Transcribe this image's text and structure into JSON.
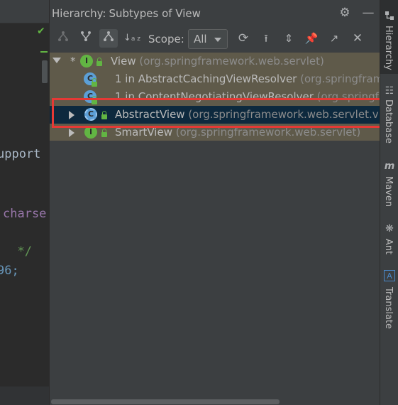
{
  "editor": {
    "code_lines": [
      {
        "text": "upport",
        "color": "#a9b7c6"
      },
      {
        "text": "charse",
        "color": "#9876aa"
      },
      {
        "text": "  */",
        "color": "#629755"
      },
      {
        "text": "96;",
        "color": "#6897bb"
      }
    ],
    "check_icon": "check-icon"
  },
  "panel": {
    "title": "Hierarchy:",
    "subtitle": "Subtypes of View",
    "scope_label": "Scope:",
    "scope_value": "All"
  },
  "tree": {
    "rows": [
      {
        "star": "*",
        "name": "View",
        "pkg": " (org.springframework.web.servlet)",
        "icon": "interface-icon",
        "icon_letter": "I"
      },
      {
        "prefix": "1 in ",
        "name": "AbstractCachingViewResolver",
        "pkg": " (org.springframework.web.servlet.view)",
        "icon": "class-icon",
        "icon_letter": "C"
      },
      {
        "prefix": "1 in ",
        "name": "ContentNegotiatingViewResolver",
        "pkg": " (org.springframework.web.servlet.view)",
        "icon": "class-icon",
        "icon_letter": "C"
      },
      {
        "name": "AbstractView",
        "pkg": " (org.springframework.web.servlet.view)",
        "icon": "abstract-class-icon",
        "icon_letter": "C"
      },
      {
        "name": "SmartView",
        "pkg": " (org.springframework.web.servlet)",
        "icon": "interface-icon",
        "icon_letter": "I"
      }
    ]
  },
  "strip": {
    "items": [
      {
        "label": "Hierarchy",
        "icon": "hierarchy-icon"
      },
      {
        "label": "Database",
        "icon": "database-icon"
      },
      {
        "label": "Maven",
        "icon": "maven-icon"
      },
      {
        "label": "Ant",
        "icon": "ant-icon"
      },
      {
        "label": "Translate",
        "icon": "translate-icon"
      }
    ]
  },
  "colors": {
    "tree_bg": "#5f5a4a",
    "selected_bg": "#0d293e",
    "highlight": "#e53935",
    "interface": "#62b543",
    "class": "#5c9fd6"
  }
}
